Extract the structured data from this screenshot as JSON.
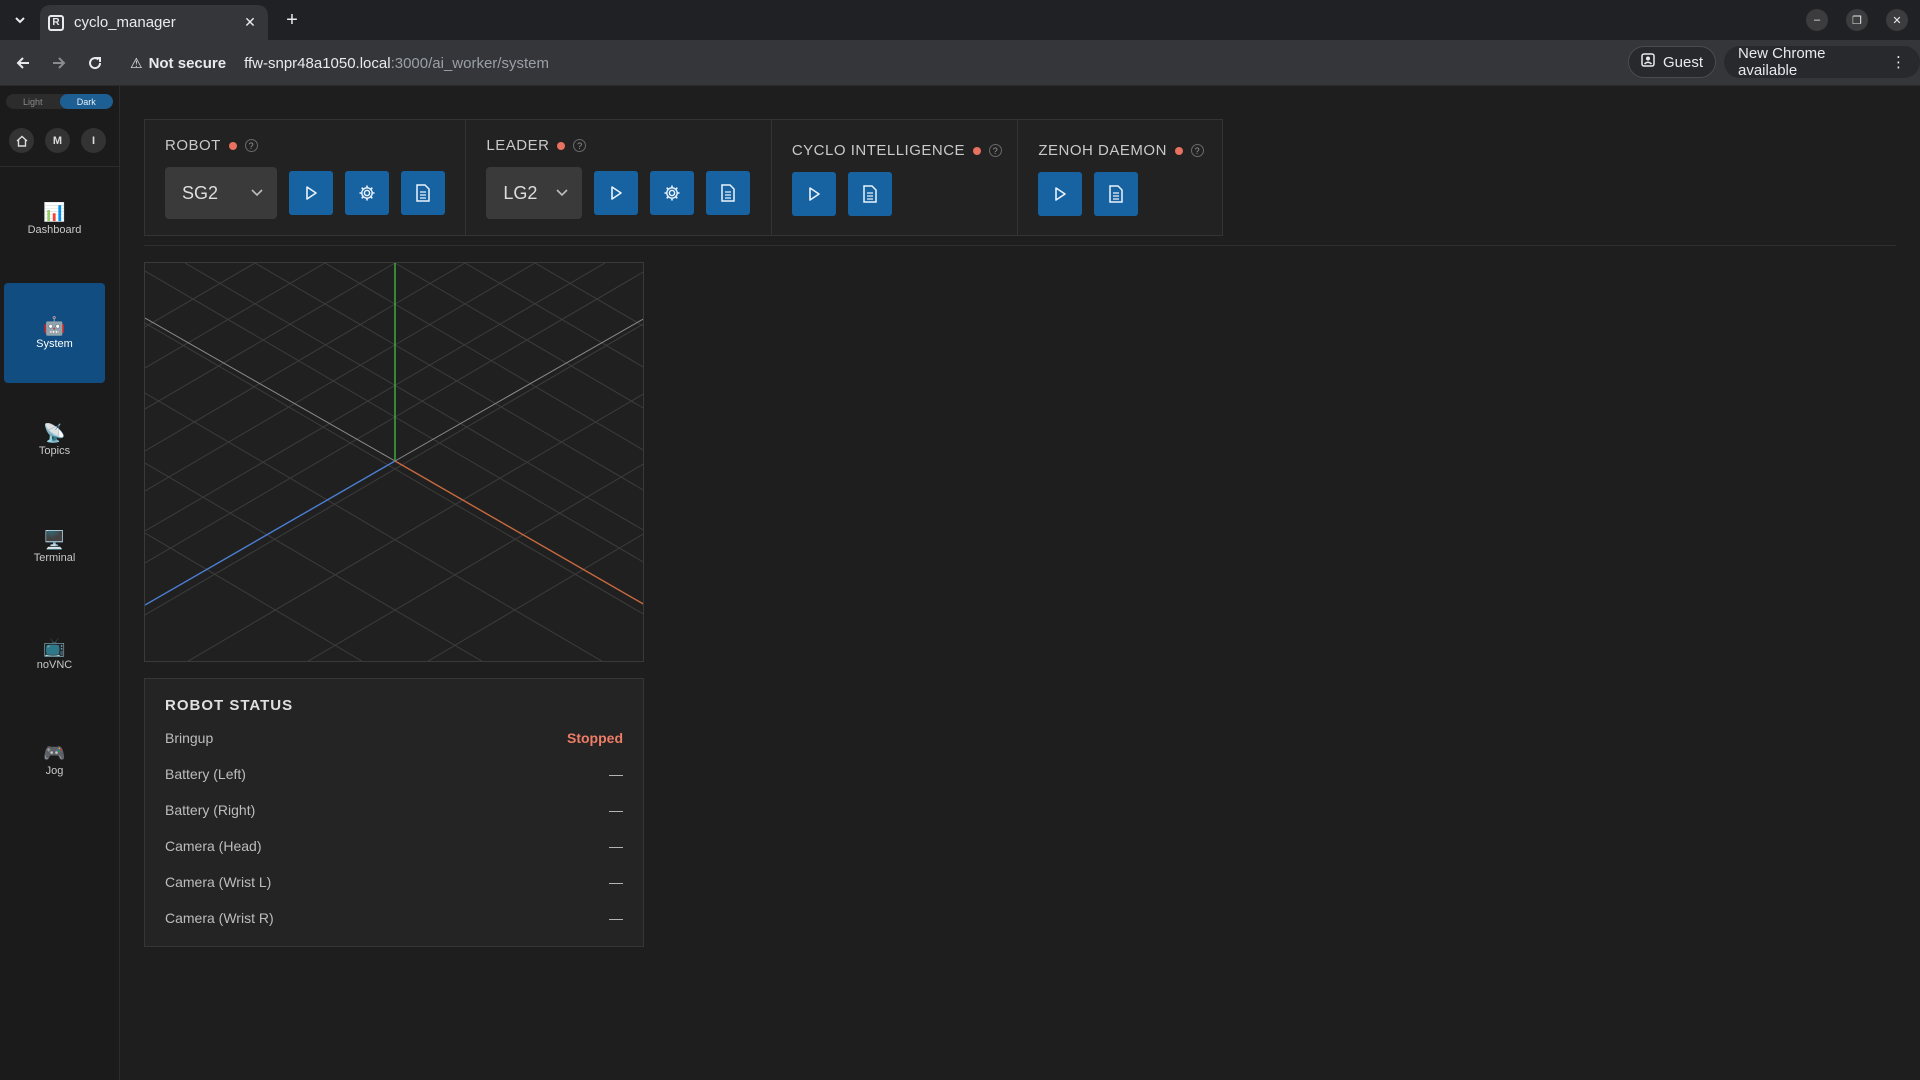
{
  "browser": {
    "tab_title": "cyclo_manager",
    "address": {
      "security_label": "Not secure",
      "url_host": "ffw-snpr48a1050.local",
      "url_path": ":3000/ai_worker/system"
    },
    "profile_label": "Guest",
    "update_label": "New Chrome available"
  },
  "sidebar": {
    "theme": {
      "light": "Light",
      "dark": "Dark"
    },
    "quick": [
      "M",
      "I"
    ],
    "nav": [
      {
        "label": "Dashboard",
        "emoji": "📊"
      },
      {
        "label": "System",
        "emoji": "🤖"
      },
      {
        "label": "Topics",
        "emoji": "📡"
      },
      {
        "label": "Terminal",
        "emoji": "🖥️"
      },
      {
        "label": "noVNC",
        "emoji": "📺"
      },
      {
        "label": "Jog",
        "emoji": "🎮"
      }
    ]
  },
  "controls": {
    "robot": {
      "title": "ROBOT",
      "help": "?",
      "selected": "SG2"
    },
    "leader": {
      "title": "LEADER",
      "help": "?",
      "selected": "LG2"
    },
    "cyclo": {
      "title": "CYCLO INTELLIGENCE",
      "help": "?"
    },
    "zenoh": {
      "title": "ZENOH DAEMON",
      "help": "?"
    },
    "status_color": "#e8715f",
    "button_color": "#1762a1"
  },
  "robot_status": {
    "title": "ROBOT STATUS",
    "rows": [
      {
        "label": "Bringup",
        "value": "Stopped"
      },
      {
        "label": "Battery (Left)",
        "value": "—"
      },
      {
        "label": "Battery (Right)",
        "value": "—"
      },
      {
        "label": "Camera (Head)",
        "value": "—"
      },
      {
        "label": "Camera (Wrist L)",
        "value": "—"
      },
      {
        "label": "Camera (Wrist R)",
        "value": "—"
      }
    ]
  }
}
